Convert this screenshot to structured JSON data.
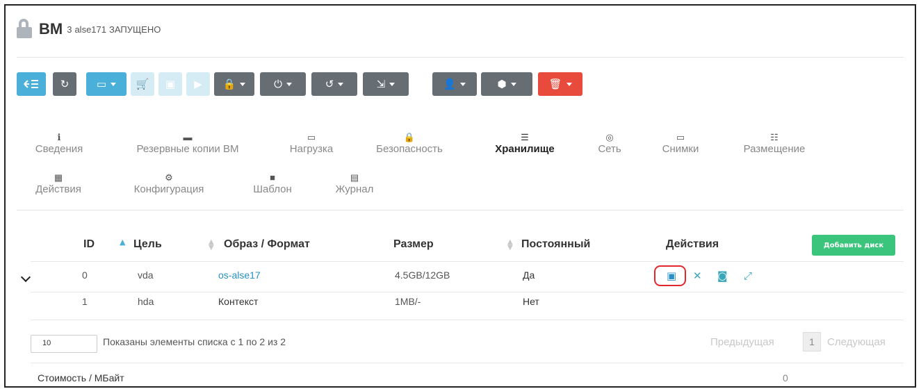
{
  "header": {
    "title": "ВМ",
    "id": "3",
    "name": "alse171",
    "state": "ЗАПУЩЕНО"
  },
  "tabs": [
    {
      "label": "Сведения",
      "icon": "info-icon"
    },
    {
      "label": "Резервные копии ВМ",
      "icon": "archive-icon"
    },
    {
      "label": "Нагрузка",
      "icon": "laptop-icon"
    },
    {
      "label": "Безопасность",
      "icon": "lock-icon"
    },
    {
      "label": "Хранилище",
      "icon": "server-icon",
      "active": true
    },
    {
      "label": "Сеть",
      "icon": "globe-icon"
    },
    {
      "label": "Снимки",
      "icon": "laptop-icon"
    },
    {
      "label": "Размещение",
      "icon": "sitemap-icon"
    },
    {
      "label": "Действия",
      "icon": "calendar-icon"
    },
    {
      "label": "Конфигурация",
      "icon": "gear-icon"
    },
    {
      "label": "Шаблон",
      "icon": "file-icon"
    },
    {
      "label": "Журнал",
      "icon": "file-text-icon"
    }
  ],
  "table": {
    "headers": {
      "id": "ID",
      "target": "Цель",
      "image": "Образ / Формат",
      "size": "Размер",
      "persistent": "Постоянный",
      "actions": "Действия"
    },
    "add_button": "Добавить диск",
    "rows": [
      {
        "id": "0",
        "target": "vda",
        "image": "os-alse17",
        "size": "4.5GB/12GB",
        "persistent": "Да"
      },
      {
        "id": "1",
        "target": "hda",
        "image": "Контекст",
        "size": "1MB/-",
        "persistent": "Нет"
      }
    ]
  },
  "footer": {
    "page_size": "10",
    "info": "Показаны элементы списка с 1 по 2 из 2",
    "prev": "Предыдущая",
    "page": "1",
    "next": "Следующая",
    "cost_label": "Стоимость / МБайт",
    "cost_value": "0"
  },
  "colors": {
    "primary": "#4ab0d9",
    "danger": "#e84a3b",
    "success": "#3bc47b",
    "neutral": "#666d73",
    "highlight": "#e3262b"
  }
}
